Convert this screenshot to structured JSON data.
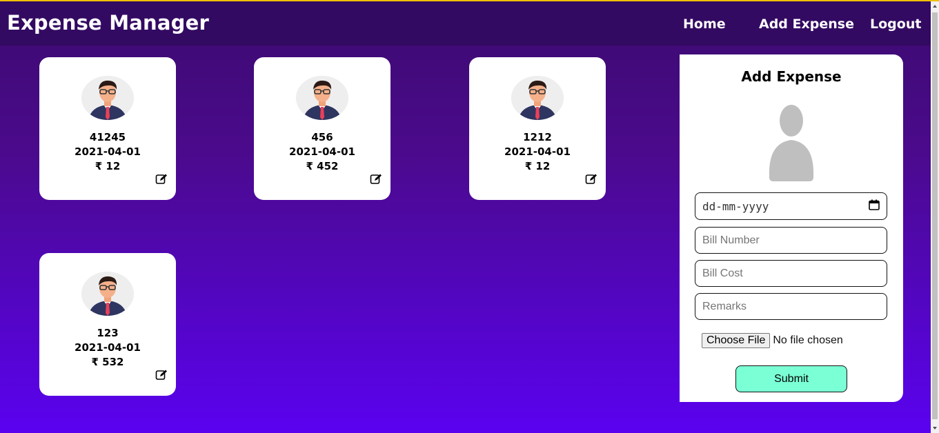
{
  "header": {
    "brand": "Expense Manager",
    "nav": [
      "Home",
      "Add Expense",
      "Logout"
    ]
  },
  "expenses": [
    {
      "bill_number": "41245",
      "date": "2021-04-01",
      "cost": "₹ 12"
    },
    {
      "bill_number": "456",
      "date": "2021-04-01",
      "cost": "₹ 452"
    },
    {
      "bill_number": "1212",
      "date": "2021-04-01",
      "cost": "₹ 12"
    },
    {
      "bill_number": "123",
      "date": "2021-04-01",
      "cost": "₹ 532"
    }
  ],
  "form": {
    "title": "Add Expense",
    "date_placeholder": "dd-mm-yyyy",
    "bill_number_placeholder": "Bill Number",
    "bill_cost_placeholder": "Bill Cost",
    "remarks_placeholder": "Remarks",
    "choose_file_label": "Choose File",
    "no_file_text": "No file chosen",
    "submit_label": "Submit"
  },
  "colors": {
    "navbar": "#330a62",
    "accent_top": "#f0c000",
    "submit_bg": "#7bffd5"
  }
}
